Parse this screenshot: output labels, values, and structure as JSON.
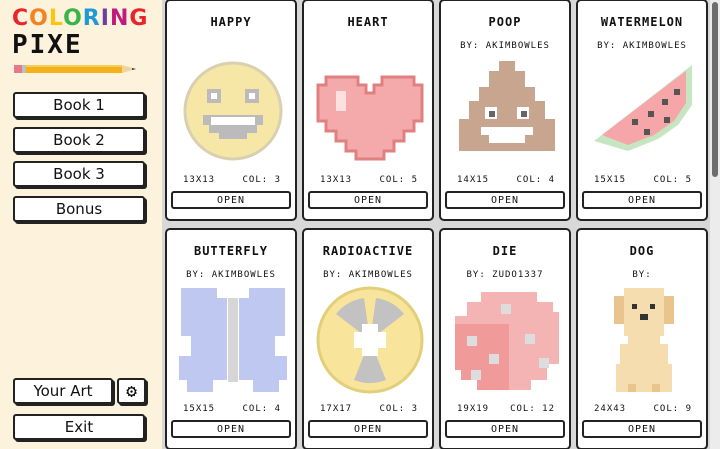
{
  "logo": {
    "line1": "COLORING",
    "line2": "PIXE",
    "line1_colors": [
      "#e8242c",
      "#f5821f",
      "#f9c80e",
      "#38b449",
      "#1f9ad6",
      "#6b3fa0",
      "#c1197c",
      "#e8242c"
    ]
  },
  "sidebar": {
    "books": [
      "Book 1",
      "Book 2",
      "Book 3",
      "Bonus"
    ],
    "your_art": "Your Art",
    "exit": "Exit",
    "settings_icon": "gear-icon"
  },
  "cards": [
    {
      "title": "HAPPY",
      "author": "",
      "size": "13X13",
      "cols": "COL: 3",
      "open": "OPEN",
      "art": "smiley"
    },
    {
      "title": "HEART",
      "author": "",
      "size": "13X13",
      "cols": "COL: 5",
      "open": "OPEN",
      "art": "heart"
    },
    {
      "title": "POOP",
      "author": "BY: AKIMBOWLES",
      "size": "14X15",
      "cols": "COL: 4",
      "open": "OPEN",
      "art": "poop"
    },
    {
      "title": "WATERMELON",
      "author": "BY: AKIMBOWLES",
      "size": "15X15",
      "cols": "COL: 5",
      "open": "OPEN",
      "art": "watermelon"
    },
    {
      "title": "BUTTERFLY",
      "author": "BY: AKIMBOWLES",
      "size": "15X15",
      "cols": "COL: 4",
      "open": "OPEN",
      "art": "butterfly"
    },
    {
      "title": "RADIOACTIVE",
      "author": "BY: AKIMBOWLES",
      "size": "17X17",
      "cols": "COL: 3",
      "open": "OPEN",
      "art": "radioactive"
    },
    {
      "title": "DIE",
      "author": "BY: ZUDO1337",
      "size": "19X19",
      "cols": "COL: 12",
      "open": "OPEN",
      "art": "die"
    },
    {
      "title": "DOG",
      "author": "BY:",
      "size": "24X43",
      "cols": "COL: 9",
      "open": "OPEN",
      "art": "dog"
    }
  ]
}
